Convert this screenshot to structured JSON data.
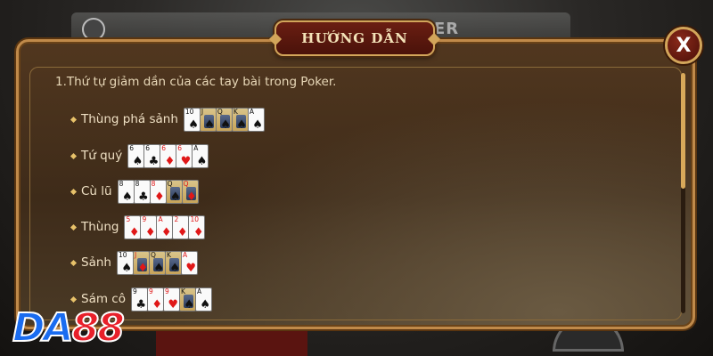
{
  "background": {
    "poker_text": "KER"
  },
  "dialog": {
    "title": "HƯỚNG DẪN",
    "close_label": "X",
    "heading": "1.Thứ tự giảm dần của các tay bài trong Poker.",
    "hands": [
      {
        "label": "Thùng phá sảnh",
        "cards": [
          {
            "rank": "10",
            "suit": "♠",
            "color": "black",
            "face": false
          },
          {
            "rank": "J",
            "suit": "♠",
            "color": "black",
            "face": true
          },
          {
            "rank": "Q",
            "suit": "♠",
            "color": "black",
            "face": true
          },
          {
            "rank": "K",
            "suit": "♠",
            "color": "black",
            "face": true
          },
          {
            "rank": "A",
            "suit": "♠",
            "color": "black",
            "face": false
          }
        ]
      },
      {
        "label": "Tứ quý",
        "cards": [
          {
            "rank": "6",
            "suit": "♠",
            "color": "black",
            "face": false
          },
          {
            "rank": "6",
            "suit": "♣",
            "color": "black",
            "face": false
          },
          {
            "rank": "6",
            "suit": "♦",
            "color": "red",
            "face": false
          },
          {
            "rank": "6",
            "suit": "♥",
            "color": "red",
            "face": false
          },
          {
            "rank": "A",
            "suit": "♠",
            "color": "black",
            "face": false
          }
        ]
      },
      {
        "label": "Cù lũ",
        "cards": [
          {
            "rank": "8",
            "suit": "♠",
            "color": "black",
            "face": false
          },
          {
            "rank": "8",
            "suit": "♣",
            "color": "black",
            "face": false
          },
          {
            "rank": "8",
            "suit": "♦",
            "color": "red",
            "face": false
          },
          {
            "rank": "Q",
            "suit": "♠",
            "color": "black",
            "face": true
          },
          {
            "rank": "Q",
            "suit": "♦",
            "color": "red",
            "face": true
          }
        ]
      },
      {
        "label": "Thùng",
        "cards": [
          {
            "rank": "5",
            "suit": "♦",
            "color": "red",
            "face": false
          },
          {
            "rank": "9",
            "suit": "♦",
            "color": "red",
            "face": false
          },
          {
            "rank": "A",
            "suit": "♦",
            "color": "red",
            "face": false
          },
          {
            "rank": "2",
            "suit": "♦",
            "color": "red",
            "face": false
          },
          {
            "rank": "10",
            "suit": "♦",
            "color": "red",
            "face": false
          }
        ]
      },
      {
        "label": "Sảnh",
        "cards": [
          {
            "rank": "10",
            "suit": "♠",
            "color": "black",
            "face": false
          },
          {
            "rank": "J",
            "suit": "♦",
            "color": "red",
            "face": true
          },
          {
            "rank": "Q",
            "suit": "♠",
            "color": "black",
            "face": true
          },
          {
            "rank": "K",
            "suit": "♠",
            "color": "black",
            "face": true
          },
          {
            "rank": "A",
            "suit": "♥",
            "color": "red",
            "face": false
          }
        ]
      },
      {
        "label": "Sám cô",
        "cards": [
          {
            "rank": "9",
            "suit": "♣",
            "color": "black",
            "face": false
          },
          {
            "rank": "9",
            "suit": "♦",
            "color": "red",
            "face": false
          },
          {
            "rank": "9",
            "suit": "♥",
            "color": "red",
            "face": false
          },
          {
            "rank": "K",
            "suit": "♠",
            "color": "black",
            "face": true
          },
          {
            "rank": "A",
            "suit": "♠",
            "color": "black",
            "face": false
          }
        ]
      }
    ]
  },
  "logo": {
    "part1": "DA",
    "part2": "88"
  },
  "colors": {
    "accent_gold": "#d2a55a",
    "panel_brown": "#3e2b19",
    "title_red": "#6a1e12"
  }
}
